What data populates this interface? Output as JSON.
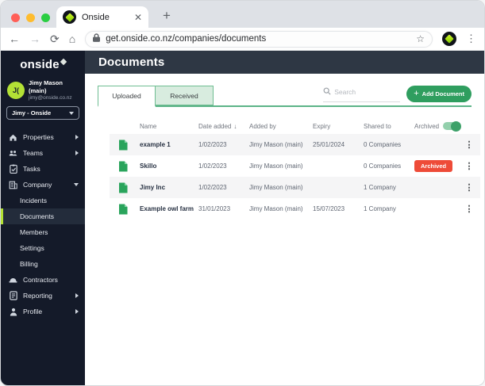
{
  "browser": {
    "tab_title": "Onside",
    "url": "get.onside.co.nz/companies/documents"
  },
  "sidebar": {
    "logo": "onside",
    "user": {
      "initials": "J(",
      "name": "Jimy Mason (main)",
      "email": "jimy@onside.co.nz"
    },
    "org_selector": "Jimy - Onside",
    "items": [
      {
        "label": "Properties",
        "icon": "home-icon",
        "chevron": "right"
      },
      {
        "label": "Teams",
        "icon": "teams-icon",
        "chevron": "right"
      },
      {
        "label": "Tasks",
        "icon": "tasks-icon"
      },
      {
        "label": "Company",
        "icon": "company-icon",
        "chevron": "down"
      },
      {
        "label": "Incidents",
        "sub": true
      },
      {
        "label": "Documents",
        "sub": true,
        "active": true
      },
      {
        "label": "Members",
        "sub": true
      },
      {
        "label": "Settings",
        "sub": true
      },
      {
        "label": "Billing",
        "sub": true
      },
      {
        "label": "Contractors",
        "icon": "contractors-icon"
      },
      {
        "label": "Reporting",
        "icon": "reporting-icon",
        "chevron": "right"
      },
      {
        "label": "Profile",
        "icon": "profile-icon",
        "chevron": "right"
      }
    ]
  },
  "main": {
    "title": "Documents",
    "tabs": [
      {
        "label": "Uploaded",
        "active": true
      },
      {
        "label": "Received",
        "active": false
      }
    ],
    "search_placeholder": "Search",
    "add_button": {
      "icon": "+",
      "label": "Add Document"
    },
    "table": {
      "columns": [
        "Name",
        "Date added",
        "Added by",
        "Expiry",
        "Shared to",
        "Archived"
      ],
      "sort_icon": "↓",
      "archived_toggle_on": true,
      "rows": [
        {
          "name": "example 1",
          "date_added": "1/02/2023",
          "added_by": "Jimy Mason (main)",
          "expiry": "25/01/2024",
          "shared_to": "0 Companies",
          "badge": ""
        },
        {
          "name": "Skillo",
          "date_added": "1/02/2023",
          "added_by": "Jimy Mason (main)",
          "expiry": "",
          "shared_to": "0 Companies",
          "badge": "Archived"
        },
        {
          "name": "Jimy Inc",
          "date_added": "1/02/2023",
          "added_by": "Jimy Mason (main)",
          "expiry": "",
          "shared_to": "1 Company",
          "badge": ""
        },
        {
          "name": "Example owl farm",
          "date_added": "31/01/2023",
          "added_by": "Jimy Mason (main)",
          "expiry": "15/07/2023",
          "shared_to": "1 Company",
          "badge": ""
        }
      ]
    }
  },
  "colors": {
    "brand_lime": "#b3e135",
    "action_green": "#2f9e5f",
    "tab_green_border": "#6fbd92",
    "tab_green_fill": "#d8ecdf",
    "archived_red": "#ee4b38",
    "sidebar_bg": "#141a29",
    "page_header_bg": "#2e3744",
    "doc_icon_green": "#2aa45c"
  }
}
